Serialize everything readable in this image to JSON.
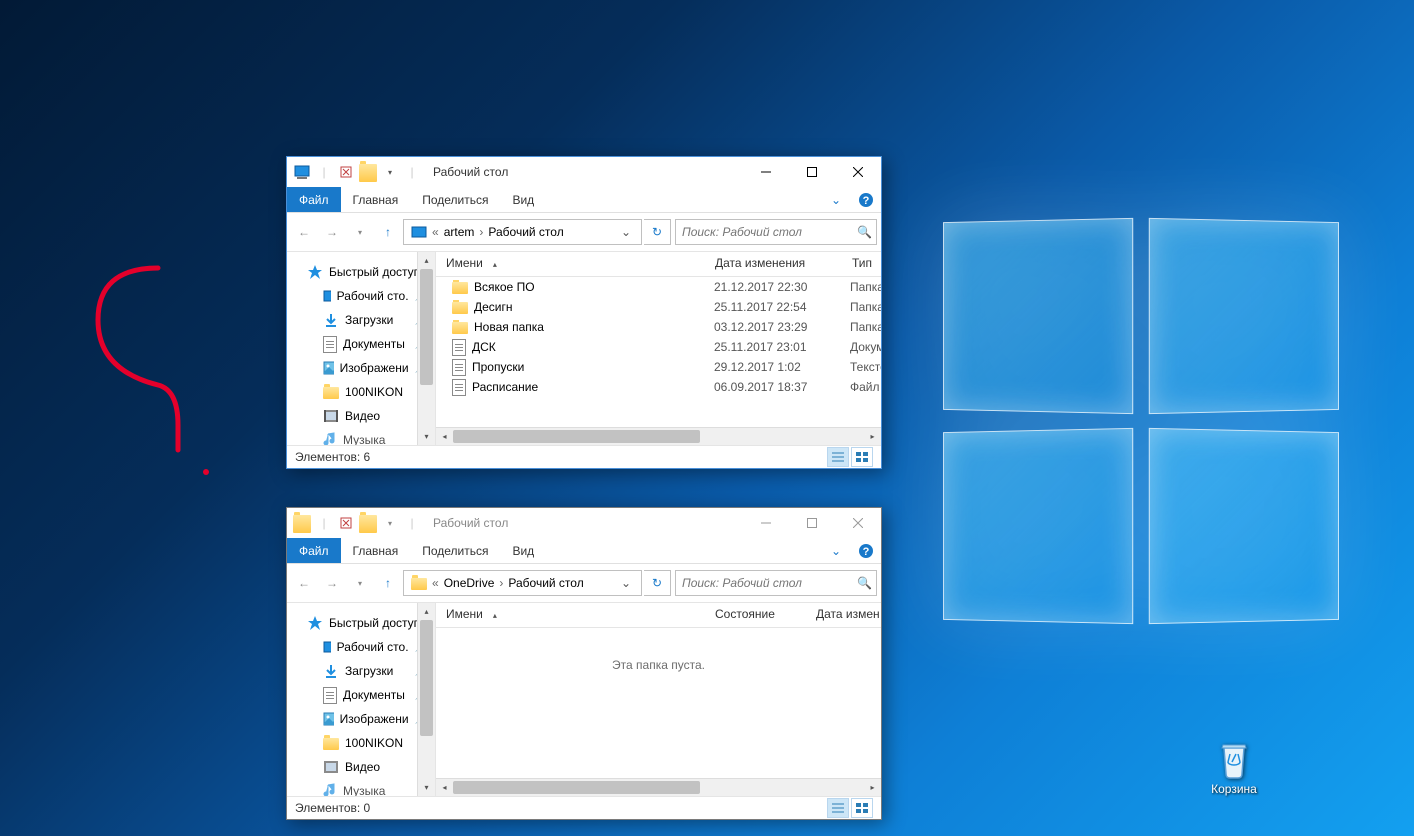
{
  "desktop": {
    "recycle_label": "Корзина"
  },
  "win1": {
    "title": "Рабочий стол",
    "tabs": {
      "file": "Файл",
      "home": "Главная",
      "share": "Поделиться",
      "view": "Вид"
    },
    "breadcrumb": {
      "pre": "«",
      "seg1": "artem",
      "seg2": "Рабочий стол"
    },
    "search_placeholder": "Поиск: Рабочий стол",
    "nav": {
      "quick": "Быстрый доступ",
      "desktop": "Рабочий сто.",
      "downloads": "Загрузки",
      "documents": "Документы",
      "pictures": "Изображени",
      "nikon": "100NIKON",
      "video": "Видео",
      "music": "Музыка"
    },
    "cols": {
      "name": "Имени",
      "date": "Дата изменения",
      "type": "Тип"
    },
    "rows": [
      {
        "icon": "folder",
        "name": "Всякое ПО",
        "date": "21.12.2017 22:30",
        "type": "Папка"
      },
      {
        "icon": "folder",
        "name": "Десигн",
        "date": "25.11.2017 22:54",
        "type": "Папка"
      },
      {
        "icon": "folder",
        "name": "Новая папка",
        "date": "03.12.2017 23:29",
        "type": "Папка"
      },
      {
        "icon": "doc",
        "name": "ДСК",
        "date": "25.11.2017 23:01",
        "type": "Докуме"
      },
      {
        "icon": "doc",
        "name": "Пропуски",
        "date": "29.12.2017 1:02",
        "type": "Тексто"
      },
      {
        "icon": "doc",
        "name": "Расписание",
        "date": "06.09.2017 18:37",
        "type": "Файл \""
      }
    ],
    "status": "Элементов: 6"
  },
  "win2": {
    "title": "Рабочий стол",
    "tabs": {
      "file": "Файл",
      "home": "Главная",
      "share": "Поделиться",
      "view": "Вид"
    },
    "breadcrumb": {
      "pre": "«",
      "seg1": "OneDrive",
      "seg2": "Рабочий стол"
    },
    "search_placeholder": "Поиск: Рабочий стол",
    "nav": {
      "quick": "Быстрый доступ",
      "desktop": "Рабочий сто.",
      "downloads": "Загрузки",
      "documents": "Документы",
      "pictures": "Изображени",
      "nikon": "100NIKON",
      "video": "Видео",
      "music": "Музыка"
    },
    "cols": {
      "name": "Имени",
      "state": "Состояние",
      "date": "Дата изменени"
    },
    "empty": "Эта папка пуста.",
    "status": "Элементов: 0"
  }
}
